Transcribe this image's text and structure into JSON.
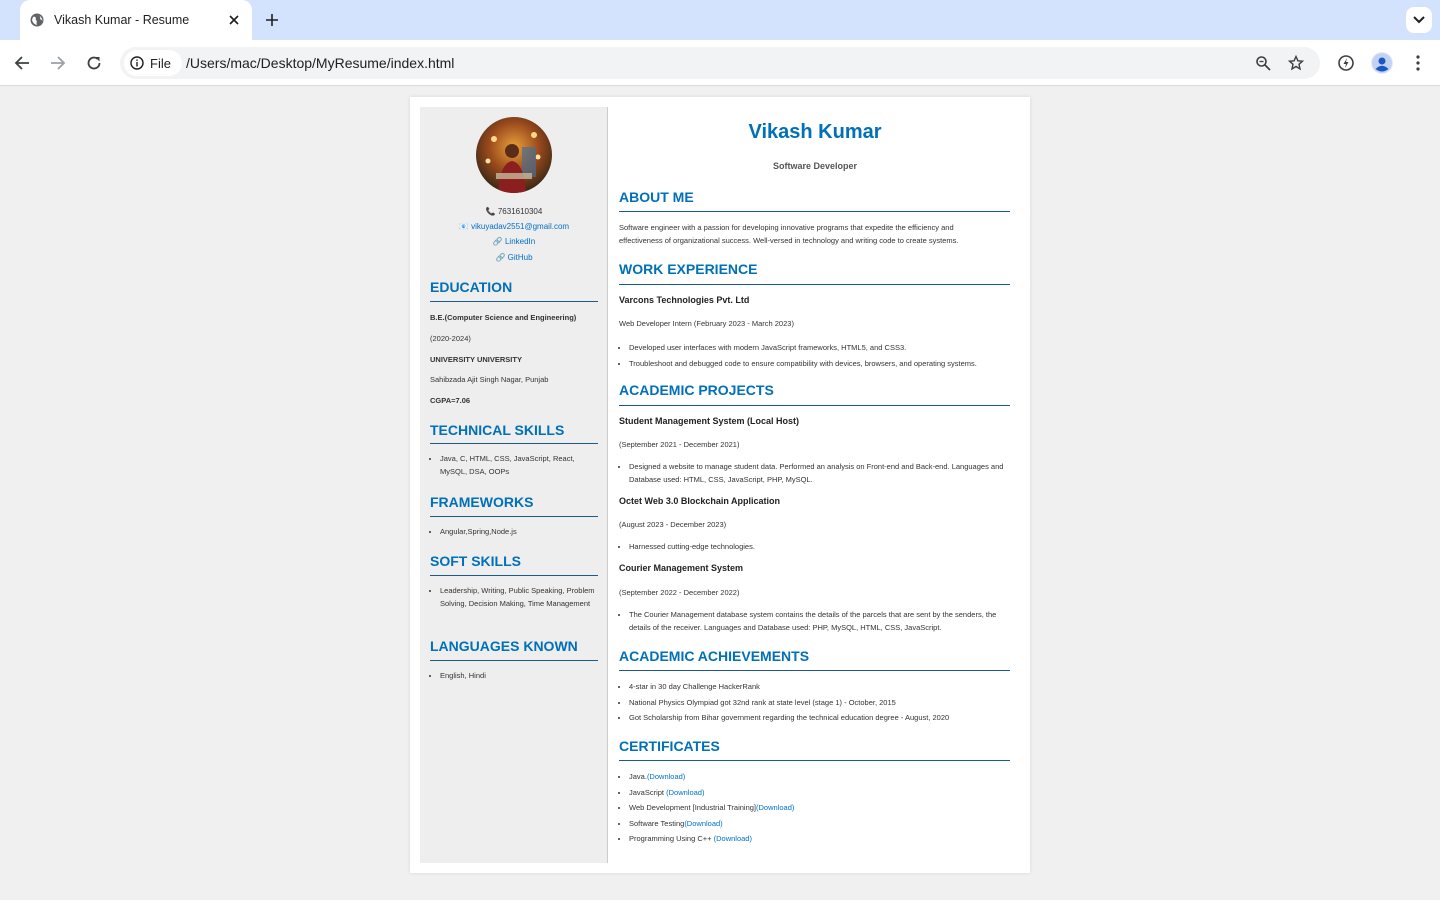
{
  "browser": {
    "tab_title": "Vikash Kumar - Resume",
    "chip_label": "File",
    "url": "/Users/mac/Desktop/MyResume/index.html"
  },
  "resume": {
    "name": "Vikash Kumar",
    "role": "Software Developer",
    "contact": {
      "phone": "📞 7631610304",
      "email": "vikuyadav2551@gmail.com",
      "linkedin": "LinkedIn",
      "github": "GitHub"
    },
    "education": {
      "heading": "EDUCATION",
      "degree": "B.E.(Computer Science and Engineering)",
      "years": "(2020-2024)",
      "university": "UNIVERSITY UNIVERSITY",
      "location": "Sahibzada Ajit Singh Nagar, Punjab",
      "cgpa": "CGPA=7.06"
    },
    "technical_skills": {
      "heading": "TECHNICAL SKILLS",
      "items": [
        "Java, C, HTML, CSS, JavaScript, React, MySQL, DSA, OOPs"
      ]
    },
    "frameworks": {
      "heading": "FRAMEWORKS",
      "items": [
        "Angular,Spring,Node.js"
      ]
    },
    "soft_skills": {
      "heading": "SOFT SKILLS",
      "items": [
        "Leadership, Writing, Public Speaking, Problem Solving, Decision Making, Time Management"
      ]
    },
    "languages": {
      "heading": "LANGUAGES KNOWN",
      "items": [
        "English, Hindi"
      ]
    },
    "about": {
      "heading": "ABOUT ME",
      "text": "Software engineer with a passion for developing innovative programs that expedite the efficiency and effectiveness of organizational success. Well-versed in technology and writing code to create systems."
    },
    "work": {
      "heading": "WORK EXPERIENCE",
      "company": "Varcons Technologies Pvt. Ltd",
      "position": "Web Developer Intern (February 2023 - March 2023)",
      "items": [
        "Developed user interfaces with modern JavaScript frameworks, HTML5, and CSS3.",
        "Troubleshoot and debugged code to ensure compatibility with devices, browsers, and operating systems."
      ]
    },
    "projects": {
      "heading": "ACADEMIC PROJECTS",
      "list": [
        {
          "title": "Student Management System (Local Host)",
          "dates": "(September 2021 - December 2021)",
          "items": [
            "Designed a website to manage student data. Performed an analysis on Front-end and Back-end. Languages and Database used: HTML, CSS, JavaScript, PHP, MySQL."
          ]
        },
        {
          "title": "Octet Web 3.0 Blockchain Application",
          "dates": "(August 2023 - December 2023)",
          "items": [
            "Harnessed cutting-edge technologies."
          ]
        },
        {
          "title": "Courier Management System",
          "dates": "(September 2022 - December 2022)",
          "items": [
            "The Courier Management database system contains the details of the parcels that are sent by the senders, the details of the receiver. Languages and Database used: PHP, MySQL, HTML, CSS, JavaScript."
          ]
        }
      ]
    },
    "achievements": {
      "heading": "ACADEMIC ACHIEVEMENTS",
      "items": [
        "4-star in 30 day Challenge HackerRank",
        "National Physics Olympiad got 32nd rank at state level (stage 1) - October, 2015",
        "Got Scholarship from Bihar government regarding the technical education degree - August, 2020"
      ]
    },
    "certificates": {
      "heading": "CERTIFICATES",
      "items": [
        {
          "name": "Java.",
          "link": "(Download)"
        },
        {
          "name": "JavaScript ",
          "link": "(Download)"
        },
        {
          "name": "Web Development [Industrial Training]",
          "link": "(Download)"
        },
        {
          "name": "Software Testing",
          "link": "(Download)"
        },
        {
          "name": "Programming Using C++ ",
          "link": "(Download)"
        }
      ]
    }
  },
  "colors": {
    "heading": "#0070b8",
    "link": "#0070c9",
    "sidebar_bg": "#eeeeee",
    "tabbar_bg": "#d3e3fd"
  }
}
